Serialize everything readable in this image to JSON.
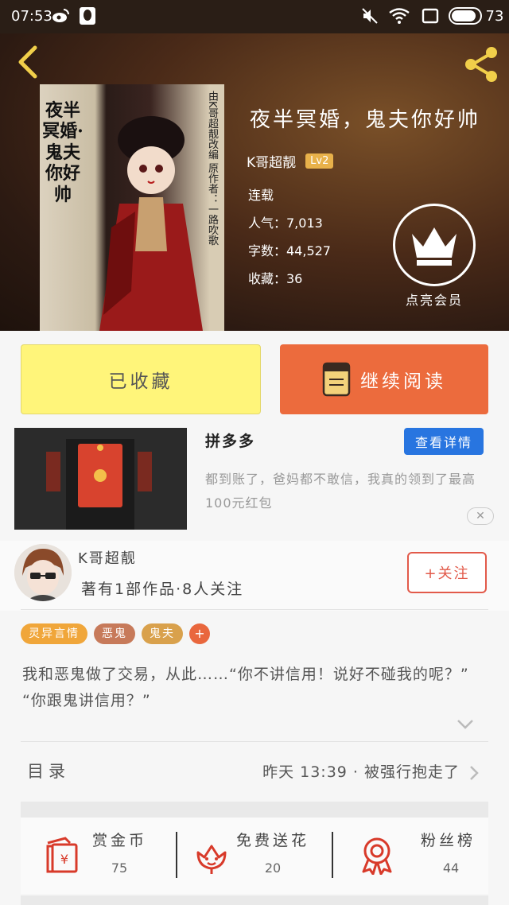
{
  "status": {
    "time": "07:53",
    "battery": "73",
    "icons": [
      "weibo-icon",
      "qq-icon",
      "mute-icon",
      "wifi-icon",
      "square-icon",
      "battery-icon"
    ]
  },
  "book": {
    "title": "夜半冥婚，鬼夫你好帅",
    "author": "K哥超靓",
    "level": "Lv2",
    "status": "连载",
    "popularity": "人气：7,013",
    "words": "字数：44,527",
    "favorites": "收藏：36",
    "cover": {
      "title_text": "夜半冥婚·鬼夫你好帅",
      "side_text": "由K哥超靓改编 原作者：一路吹歌"
    }
  },
  "vip": {
    "label": "点亮会员"
  },
  "actions": {
    "favorited": "已收藏",
    "continue": "继续阅读"
  },
  "ad": {
    "title": "拼多多",
    "detail_button": "查看详情",
    "description": "都到账了，爸妈都不敢信，我真的领到了最高100元红包",
    "close": "✕"
  },
  "author_card": {
    "name": "K哥超靓",
    "stats": "著有1部作品·8人关注",
    "follow": "+关注"
  },
  "tags": [
    {
      "label": "灵异言情",
      "color": "#f0a63a"
    },
    {
      "label": "恶鬼",
      "color": "#c77a5a"
    },
    {
      "label": "鬼夫",
      "color": "#d9a14c"
    }
  ],
  "tag_add": "+",
  "synopsis": "我和恶鬼做了交易，从此……“你不讲信用！说好不碰我的呢？” “你跟鬼讲信用？”",
  "toc": {
    "label": "目录",
    "latest": "昨天 13:39 · 被强行抱走了"
  },
  "bottom": {
    "reward": {
      "label": "赏金币",
      "value": "75"
    },
    "flower": {
      "label": "免费送花",
      "value": "20"
    },
    "fans": {
      "label": "粉丝榜",
      "value": "44"
    }
  },
  "colors": {
    "accent_orange": "#ec6b3d",
    "favorite_yellow": "#fff57a",
    "detail_blue": "#2875e0",
    "follow_red": "#e25a4a",
    "icon_red": "#d83a2a"
  }
}
